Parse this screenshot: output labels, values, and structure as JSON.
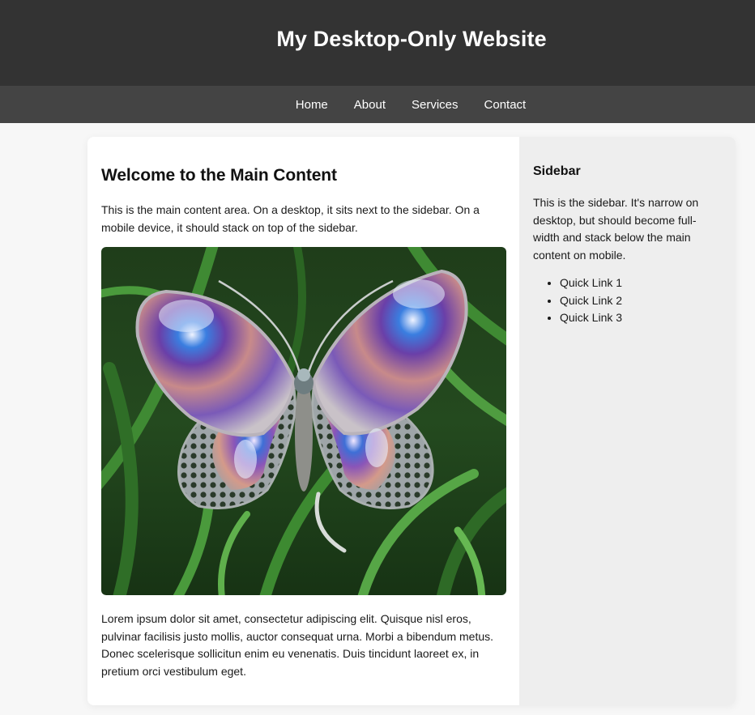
{
  "header": {
    "title": "My Desktop-Only Website"
  },
  "nav": {
    "items": [
      "Home",
      "About",
      "Services",
      "Contact"
    ]
  },
  "main": {
    "title": "Welcome to the Main Content",
    "intro": "This is the main content area. On a desktop, it sits next to the sidebar. On a mobile device, it should stack on top of the sidebar.",
    "image_icon": "butterfly-photo",
    "body": "Lorem ipsum dolor sit amet, consectetur adipiscing elit. Quisque nisl eros, pulvinar facilisis justo mollis, auctor consequat urna. Morbi a bibendum metus. Donec scelerisque sollicitun enim eu venenatis. Duis tincidunt laoreet ex, in pretium orci vestibulum eget."
  },
  "sidebar": {
    "title": "Sidebar",
    "text": "This is the sidebar. It's narrow on desktop, but should become full-width and stack below the main content on mobile.",
    "links": [
      "Quick Link 1",
      "Quick Link 2",
      "Quick Link 3"
    ]
  },
  "colors": {
    "header_bg": "#333333",
    "nav_bg": "#444444",
    "page_bg": "#f7f7f7",
    "sidebar_bg": "#eeeeee"
  }
}
